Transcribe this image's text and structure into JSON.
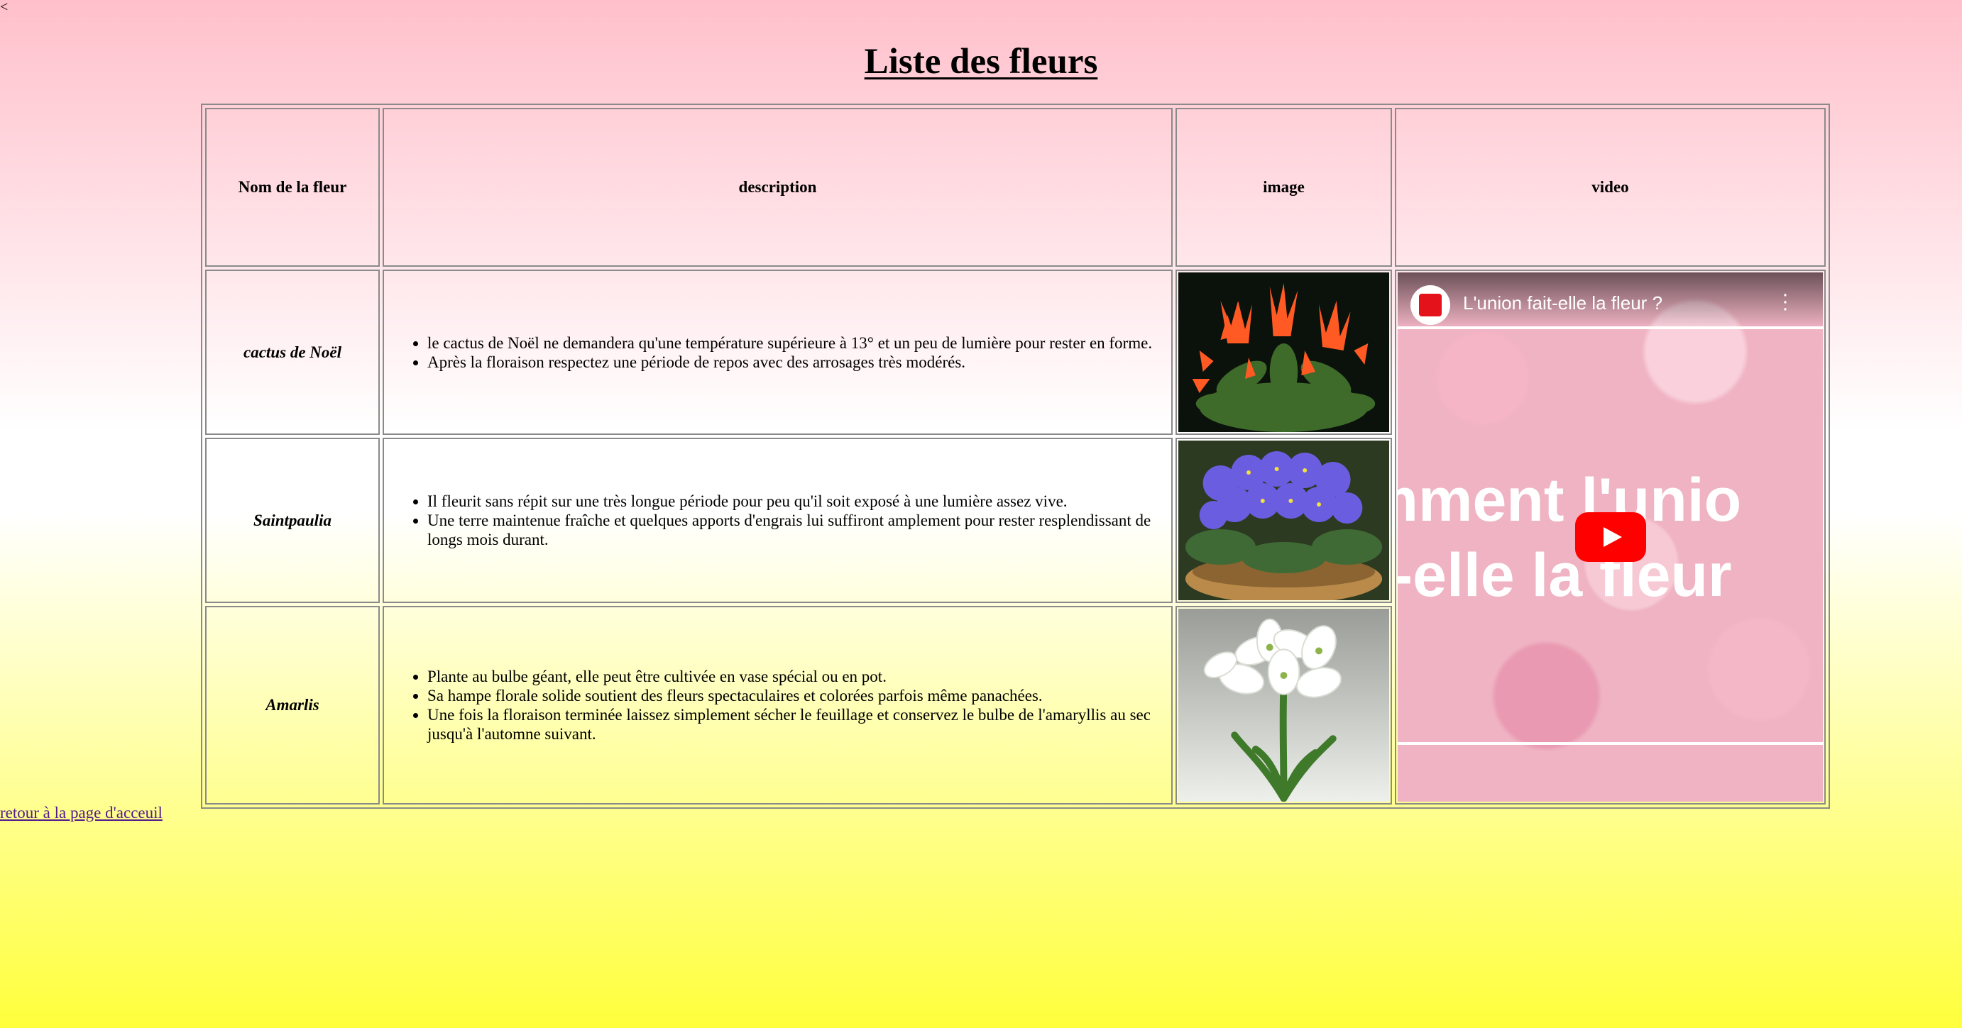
{
  "page": {
    "stray_char": "<",
    "title": "Liste des fleurs",
    "back_link": "retour à la page d'acceuil"
  },
  "table": {
    "headers": {
      "name": "Nom de la fleur",
      "description": "description",
      "image": "image",
      "video": "video"
    },
    "rows": [
      {
        "name": "cactus de Noël",
        "bullets": [
          "le cactus de Noël ne demandera qu'une température supérieure à 13° et un peu de lumière pour rester en forme.",
          "Après la floraison respectez une période de repos avec des arrosages très modérés."
        ],
        "image_icon": "christmas-cactus-photo"
      },
      {
        "name": "Saintpaulia",
        "bullets": [
          "Il fleurit sans répit sur une très longue période pour peu qu'il soit exposé à une lumière assez vive.",
          "Une terre maintenue fraîche et quelques apports d'engrais lui suffiront amplement pour rester resplendissant de longs mois durant."
        ],
        "image_icon": "african-violet-photo"
      },
      {
        "name": "Amarlis",
        "bullets": [
          "Plante au bulbe géant, elle peut être cultivée en vase spécial ou en pot.",
          "Sa hampe florale solide soutient des fleurs spectaculaires et colorées parfois même panachées.",
          "Une fois la floraison terminée laissez simplement sécher le feuillage et conservez le bulbe de l'amaryllis au sec jusqu'à l'automne suivant."
        ],
        "image_icon": "amaryllis-photo"
      }
    ]
  },
  "video": {
    "title": "L'union fait-elle la fleur ?",
    "overlay_line1": "omment l'unio",
    "overlay_line2": "it-elle la fleur",
    "brand_color": "#ff0000"
  },
  "colors": {
    "bg_top": "#ffc0cb",
    "bg_bottom": "#ffff3c",
    "link": "#551a8b"
  }
}
